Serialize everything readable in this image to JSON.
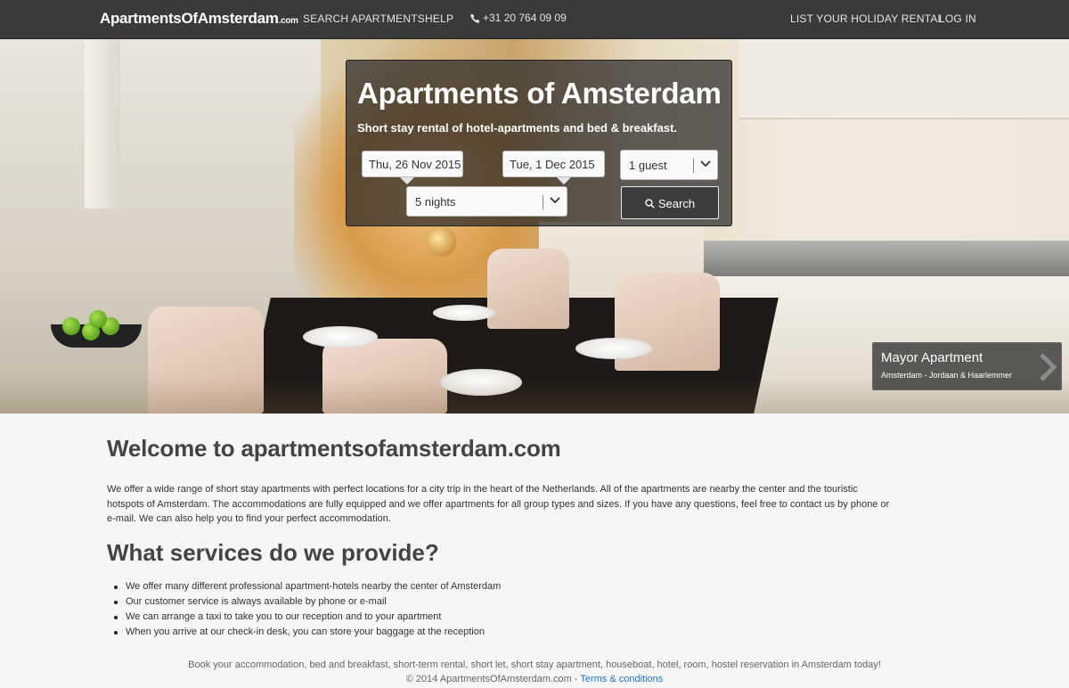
{
  "nav": {
    "brand_main": "ApartmentsOfAmsterdam",
    "brand_tld": ".com",
    "search_apartments": "SEARCH APARTMENTS",
    "help": "HELP",
    "phone": "+31 20 764 09 09",
    "list_rental": "LIST YOUR HOLIDAY RENTAL",
    "login": "LOG IN"
  },
  "search": {
    "title": "Apartments of Amsterdam",
    "subtitle": "Short stay rental of hotel-apartments and bed & breakfast.",
    "checkin": "Thu, 26 Nov 2015",
    "checkout": "Tue, 1 Dec 2015",
    "guests": "1 guest",
    "nights": "5 nights",
    "button": "Search"
  },
  "hero_caption": {
    "title": "Mayor Apartment",
    "subtitle": "Amsterdam - Jordaan & Haarlemmer"
  },
  "content": {
    "welcome_title": "Welcome to apartmentsofamsterdam.com",
    "intro": "We offer a wide range of short stay apartments with perfect locations for a city trip in the heart of the Netherlands. All of the apartments are nearby the center and the touristic hotspots of Amsterdam. The accommodations are fully equipped and we offer apartments for all group types and sizes. If you have any questions, feel free to contact us by phone or e-mail. We can also help you to find your perfect accommodation.",
    "services_title": "What services do we provide?",
    "services": [
      "We offer many different professional apartment-hotels nearby the center of Amsterdam",
      "Our customer service is always available by phone or e-mail",
      "We can arrange a taxi to take you to our reception and to your apartment",
      "When you arrive at our check-in desk, you can store your baggage at the reception"
    ]
  },
  "footer": {
    "tagline": "Book your accommodation, bed and breakfast, short-term rental, short let, short stay apartment, houseboat, hotel, room, hostel reservation in Amsterdam today!",
    "copyright": "© 2014 ApartmentsOfAmsterdam.com - ",
    "terms": "Terms & conditions"
  }
}
